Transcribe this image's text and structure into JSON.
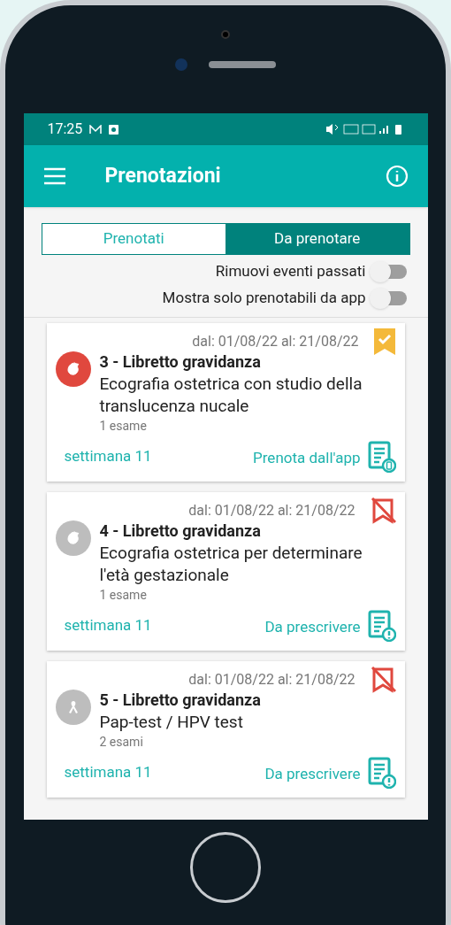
{
  "status_bar": {
    "time": "17:25"
  },
  "app_bar": {
    "title": "Prenotazioni"
  },
  "tabs": [
    {
      "label": "Prenotati",
      "selected": false
    },
    {
      "label": "Da prenotare",
      "selected": true
    }
  ],
  "toggles": [
    {
      "label": "Rimuovi eventi passati",
      "on": false
    },
    {
      "label": "Mostra solo prenotabili da app",
      "on": false
    }
  ],
  "cards": [
    {
      "dates": "dal: 01/08/22 al: 21/08/22",
      "booked": true,
      "kind": "ultrasound",
      "color": "#e0483e",
      "title": "3 - Libretto gravidanza",
      "description": "Ecografia ostetrica con studio della translucenza nucale",
      "count": "1 esame",
      "week": "settimana 11",
      "action": "Prenota dall'app",
      "app_bookable": true
    },
    {
      "dates": "dal: 01/08/22 al: 21/08/22",
      "booked": false,
      "kind": "ultrasound",
      "color": "#bdbdbd",
      "title": "4 - Libretto gravidanza",
      "description": "Ecografia ostetrica per determinare l'età gestazionale",
      "count": "1 esame",
      "week": "settimana 11",
      "action": "Da prescrivere",
      "app_bookable": false
    },
    {
      "dates": "dal: 01/08/22 al: 21/08/22",
      "booked": false,
      "kind": "screening",
      "color": "#bdbdbd",
      "title": "5 - Libretto gravidanza",
      "description": "Pap-test / HPV test",
      "count": "2 esami",
      "week": "settimana 11",
      "action": "Da prescrivere",
      "app_bookable": false
    }
  ]
}
